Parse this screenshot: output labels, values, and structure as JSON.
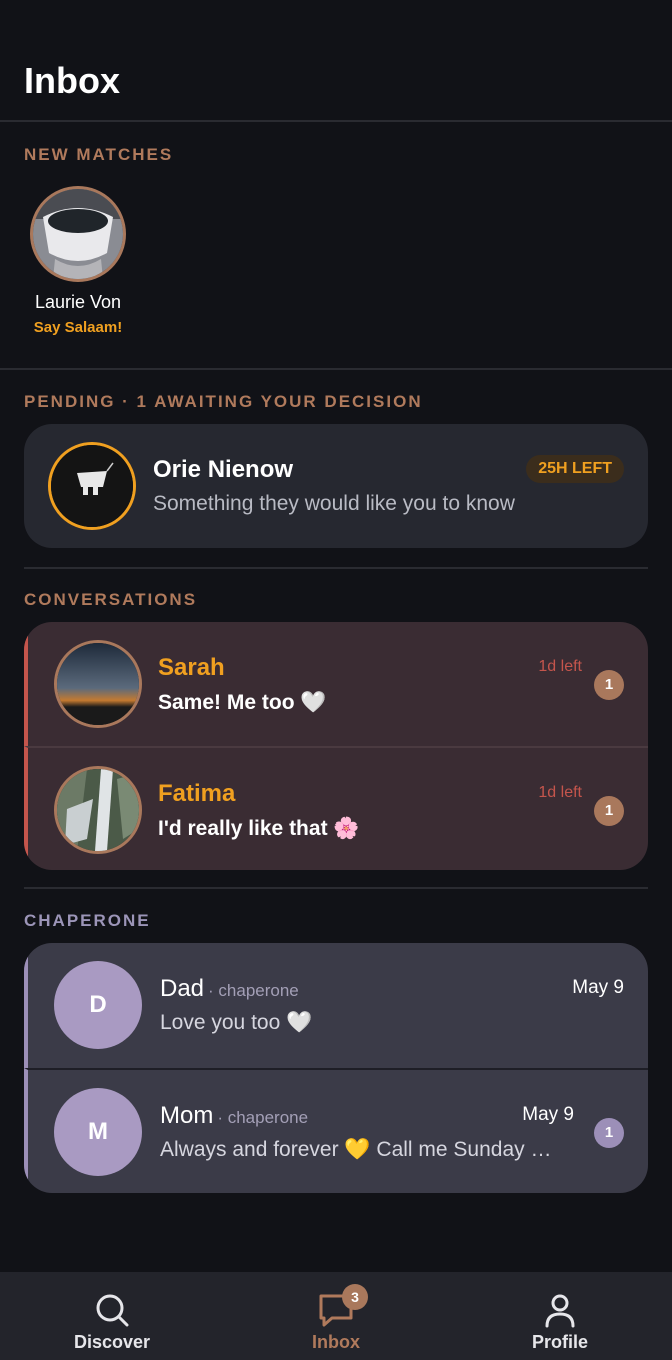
{
  "header": {
    "title": "Inbox"
  },
  "new_matches": {
    "label": "NEW MATCHES",
    "items": [
      {
        "name": "Laurie Von",
        "cta": "Say Salaam!"
      }
    ]
  },
  "pending": {
    "label": "PENDING · 1 AWAITING YOUR DECISION",
    "items": [
      {
        "name": "Orie Nienow",
        "message": "Something they would like you to know",
        "time_left": "25H LEFT"
      }
    ]
  },
  "conversations": {
    "label": "CONVERSATIONS",
    "items": [
      {
        "name": "Sarah",
        "message": "Same! Me too",
        "emoji": "🤍",
        "time": "1d left",
        "unread": "1"
      },
      {
        "name": "Fatima",
        "message": "I'd really like that",
        "emoji": "🌸",
        "time": "1d left",
        "unread": "1"
      }
    ]
  },
  "chaperone": {
    "label": "CHAPERONE",
    "items": [
      {
        "initial": "D",
        "name": "Dad",
        "tag": "· chaperone",
        "message": "Love you too 🤍",
        "date": "May 9",
        "unread": ""
      },
      {
        "initial": "M",
        "name": "Mom",
        "tag": "· chaperone",
        "message": "Always and forever 💛 Call me Sunday …",
        "date": "May 9",
        "unread": "1"
      }
    ]
  },
  "nav": {
    "items": [
      {
        "label": "Discover",
        "icon": "search-icon"
      },
      {
        "label": "Inbox",
        "icon": "chat-icon",
        "badge": "3"
      },
      {
        "label": "Profile",
        "icon": "user-icon"
      }
    ]
  },
  "colors": {
    "accent": "#f0a020",
    "brand": "#a9785c",
    "chaperone": "#9c8fb8",
    "background": "#111217"
  }
}
